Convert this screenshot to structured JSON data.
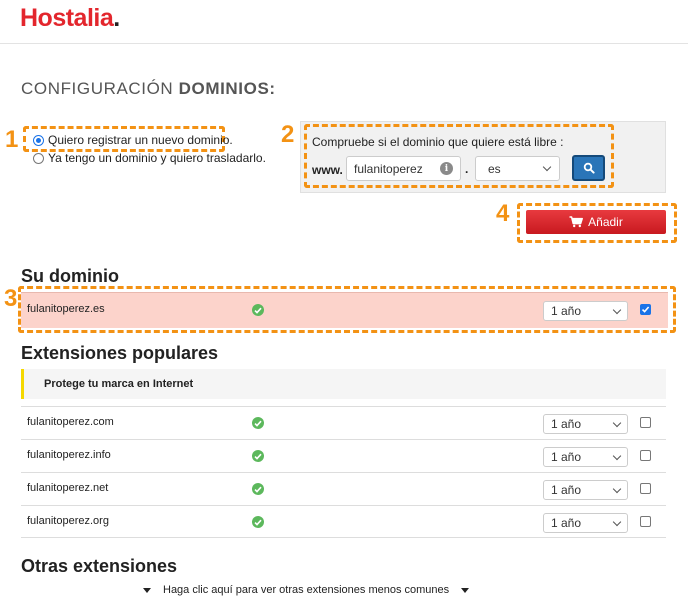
{
  "header": {
    "logo_text": "Hostalia",
    "logo_dot": "."
  },
  "page_title": {
    "prefix": "CONFIGURACIÓN",
    "bold": "DOMINIOS:"
  },
  "callouts": [
    "1",
    "2",
    "3",
    "4"
  ],
  "registration_options": [
    {
      "label": "Quiero registrar un nuevo dominio.",
      "checked": true
    },
    {
      "label": "Ya tengo un dominio y quiero trasladarlo.",
      "checked": false
    }
  ],
  "domain_check": {
    "title": "Compruebe si el dominio que quiere está libre :",
    "www_label": "www.",
    "domain_value": "fulanitoperez",
    "dot": ".",
    "extension_value": "es",
    "search_icon": "search-icon",
    "info_icon": "info-icon"
  },
  "add_button": {
    "label": "Añadir",
    "icon": "cart-icon"
  },
  "your_domain": {
    "title": "Su dominio",
    "row": {
      "domain": "fulanitoperez.es",
      "period": "1 año",
      "selected": true
    }
  },
  "popular": {
    "title": "Extensiones populares",
    "banner": "Protege tu marca en Internet",
    "rows": [
      {
        "domain": "fulanitoperez.com",
        "period": "1 año",
        "selected": false
      },
      {
        "domain": "fulanitoperez.info",
        "period": "1 año",
        "selected": false
      },
      {
        "domain": "fulanitoperez.net",
        "period": "1 año",
        "selected": false
      },
      {
        "domain": "fulanitoperez.org",
        "period": "1 año",
        "selected": false
      }
    ]
  },
  "other": {
    "title": "Otras extensiones",
    "link": "Haga clic aquí para ver otras extensiones menos comunes"
  },
  "colors": {
    "brand_red": "#e3262d",
    "callout_orange": "#f39214",
    "highlight_row": "#fcd3cb",
    "available_green": "#5cb85c",
    "search_blue": "#2a75b8",
    "banner_accent": "#f5d800"
  }
}
